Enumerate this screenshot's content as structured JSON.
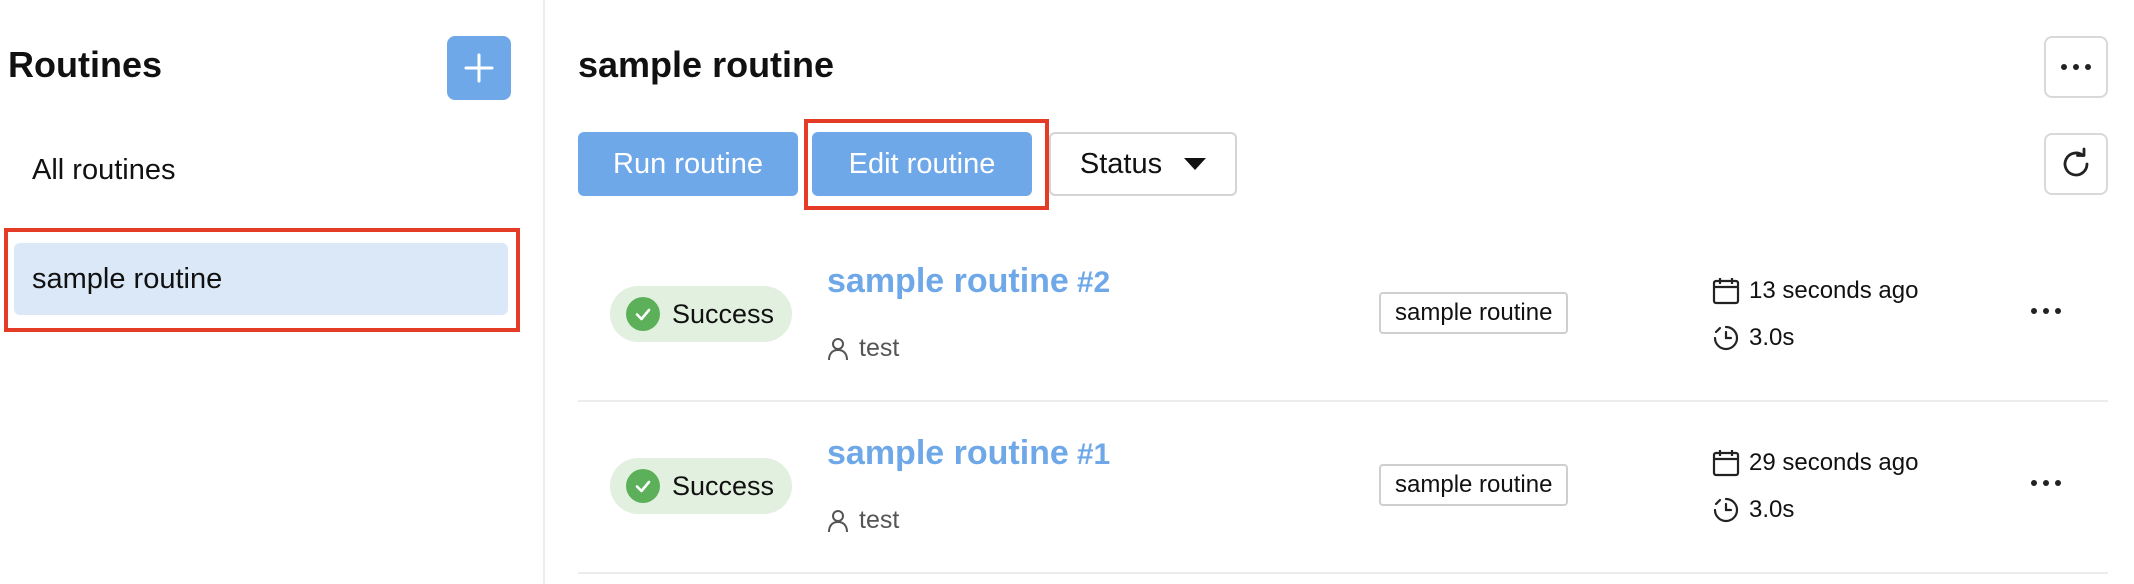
{
  "sidebar": {
    "title": "Routines",
    "items": [
      {
        "label": "All routines"
      },
      {
        "label": "sample routine"
      }
    ]
  },
  "main": {
    "title": "sample routine",
    "buttons": {
      "run": "Run routine",
      "edit": "Edit routine",
      "status": "Status"
    },
    "runs": [
      {
        "status": "Success",
        "name": "sample routine",
        "number": "#2",
        "user": "test",
        "tag": "sample routine",
        "time": "13 seconds ago",
        "duration": "3.0s"
      },
      {
        "status": "Success",
        "name": "sample routine",
        "number": "#1",
        "user": "test",
        "tag": "sample routine",
        "time": "29 seconds ago",
        "duration": "3.0s"
      }
    ]
  },
  "colors": {
    "accent": "#6fa8e9",
    "selected_bg": "#dbe8f8",
    "success": "#5db05a",
    "success_bg": "#e2f0e0",
    "highlight": "#e33b25"
  },
  "icons": [
    "plus-icon",
    "more-icon",
    "refresh-icon",
    "caret-down-icon",
    "check-icon",
    "user-icon",
    "calendar-icon",
    "clock-icon"
  ]
}
